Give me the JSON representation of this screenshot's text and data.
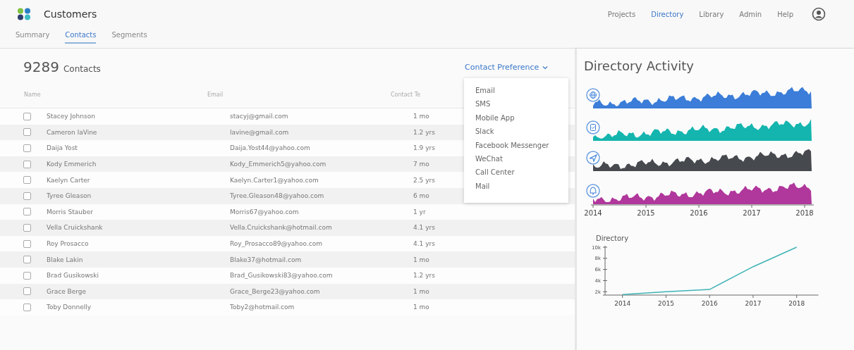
{
  "app": {
    "title": "Customers"
  },
  "nav": [
    {
      "label": "Projects",
      "selected": false
    },
    {
      "label": "Directory",
      "selected": true
    },
    {
      "label": "Library",
      "selected": false
    },
    {
      "label": "Admin",
      "selected": false
    },
    {
      "label": "Help",
      "selected": false
    }
  ],
  "tabs": [
    {
      "label": "Summary",
      "selected": false
    },
    {
      "label": "Contacts",
      "selected": true
    },
    {
      "label": "Segments",
      "selected": false
    }
  ],
  "contacts": {
    "count": "9289",
    "count_label": "Contacts",
    "filter": {
      "label": "Contact Preference",
      "expanded": true,
      "options": [
        "Email",
        "SMS",
        "Mobile App",
        "Slack",
        "Facebook Messenger",
        "WeChat",
        "Call Center",
        "Mail"
      ]
    },
    "columns": [
      "Name",
      "Email",
      "Contact Te"
    ],
    "rows": [
      {
        "checked": false,
        "name": "Stacey Johnson",
        "email": "stacyj@gmail.com",
        "term": "1 mo"
      },
      {
        "checked": false,
        "name": "Cameron laVine",
        "email": "lavine@gmail.com",
        "term": "1.2 yrs"
      },
      {
        "checked": false,
        "name": "Daija Yost",
        "email": "Daija.Yost44@yahoo.com",
        "term": "1.9 yrs"
      },
      {
        "checked": false,
        "name": "Kody Emmerich",
        "email": "Kody_Emmerich5@yahoo.com",
        "term": "7 mo"
      },
      {
        "checked": false,
        "name": "Kaelyn Carter",
        "email": "Kaelyn.Carter1@yahoo.com",
        "term": "2.5 yrs"
      },
      {
        "checked": false,
        "name": "Tyree Gleason",
        "email": "Tyree.Gleason48@yahoo.com",
        "term": "6 mo"
      },
      {
        "checked": false,
        "name": "Morris Stauber",
        "email": "Morris67@yahoo.com",
        "term": "1 yr"
      },
      {
        "checked": false,
        "name": "Vella Cruickshank",
        "email": "Vella.Cruickshank@hotmail.com",
        "term": "4.1 yrs"
      },
      {
        "checked": false,
        "name": "Roy Prosacco",
        "email": "Roy_Prosacco89@yahoo.com",
        "term": "4.1 yrs"
      },
      {
        "checked": false,
        "name": "Blake Lakin",
        "email": "Blake37@hotmail.com",
        "term": "1 mo"
      },
      {
        "checked": false,
        "name": "Brad Gusikowski",
        "email": "Brad_Gusikowski83@yahoo.com",
        "term": "1.2 yrs"
      },
      {
        "checked": false,
        "name": "Grace Berge",
        "email": "Grace_Berge23@yahoo.com",
        "term": "1 mo"
      },
      {
        "checked": false,
        "name": "Toby Donnelly",
        "email": "Toby2@hotmail.com",
        "term": "1 mo"
      }
    ]
  },
  "activity": {
    "title": "Directory Activity",
    "series": [
      {
        "color": "#3b7dd8"
      },
      {
        "color": "#14b5ae"
      },
      {
        "color": "#46494d"
      },
      {
        "color": "#b0379b"
      }
    ],
    "xticks": [
      "2014",
      "2015",
      "2016",
      "2017",
      "2018"
    ]
  },
  "directory": {
    "chart_data": {
      "type": "line",
      "title": "Directory",
      "x": [
        2014,
        2015,
        2016,
        2017,
        2018
      ],
      "series": [
        {
          "color": "#3fb3b5",
          "values": [
            1500,
            2000,
            2400,
            6500,
            10000
          ]
        }
      ],
      "xlim": [
        2013.6,
        2018.5
      ],
      "ylim": [
        1400,
        10000
      ],
      "xticks": [
        2014,
        2015,
        2016,
        2017,
        2018
      ],
      "yticks": [
        {
          "value": 2000,
          "label": "2k"
        },
        {
          "value": 4000,
          "label": "4k"
        },
        {
          "value": 6000,
          "label": "6k"
        },
        {
          "value": 8000,
          "label": "8k"
        },
        {
          "value": 10000,
          "label": "10k"
        }
      ]
    }
  }
}
